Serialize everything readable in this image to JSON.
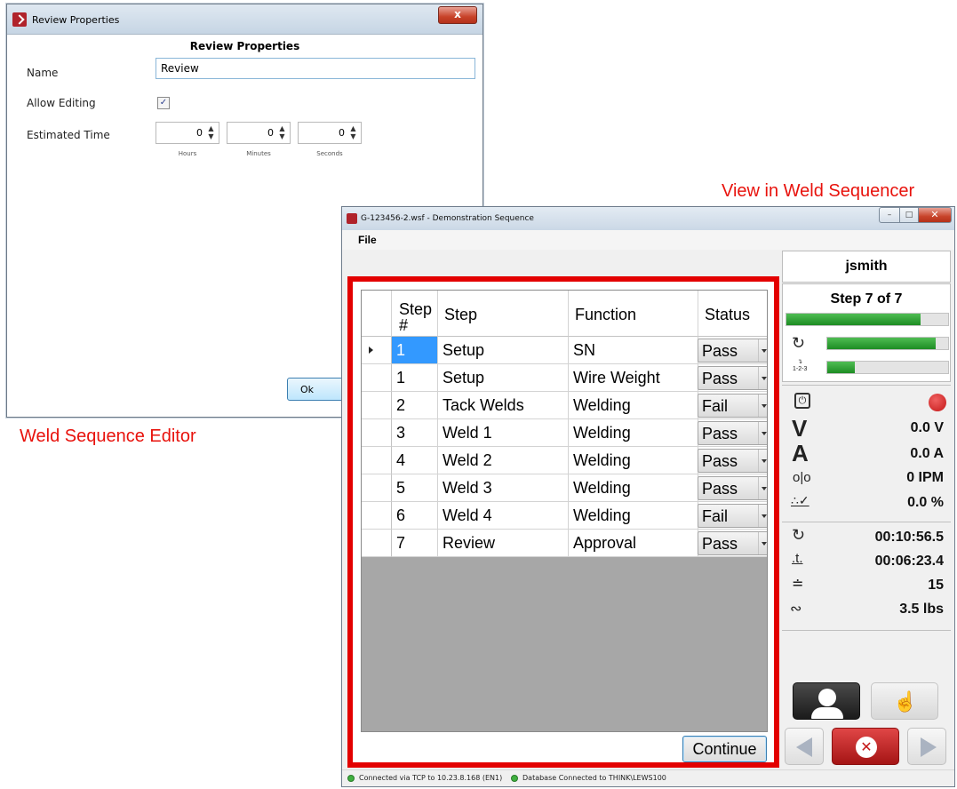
{
  "review_dialog": {
    "title": "Review Properties",
    "close_glyph": "x",
    "heading": "Review Properties",
    "name_label": "Name",
    "name_value": "Review",
    "allow_editing_label": "Allow Editing",
    "allow_editing_checked": true,
    "estimated_time_label": "Estimated Time",
    "hours_value": "0",
    "minutes_value": "0",
    "seconds_value": "0",
    "hours_caption": "Hours",
    "minutes_caption": "Minutes",
    "seconds_caption": "Seconds",
    "ok_label": "Ok"
  },
  "captions": {
    "editor": "Weld Sequence Editor",
    "sequencer": "View in Weld Sequencer"
  },
  "sequencer": {
    "title": "G-123456-2.wsf - Demonstration Sequence",
    "menu_file": "File",
    "columns": {
      "step_num_line1": "Step",
      "step_num_line2": "#",
      "step": "Step",
      "function": "Function",
      "status": "Status"
    },
    "rows": [
      {
        "num": "1",
        "step": "Setup",
        "function": "SN",
        "status": "Pass"
      },
      {
        "num": "1",
        "step": "Setup",
        "function": "Wire Weight",
        "status": "Pass"
      },
      {
        "num": "2",
        "step": "Tack Welds",
        "function": "Welding",
        "status": "Fail"
      },
      {
        "num": "3",
        "step": "Weld 1",
        "function": "Welding",
        "status": "Pass"
      },
      {
        "num": "4",
        "step": "Weld 2",
        "function": "Welding",
        "status": "Pass"
      },
      {
        "num": "5",
        "step": "Weld 3",
        "function": "Welding",
        "status": "Pass"
      },
      {
        "num": "6",
        "step": "Weld 4",
        "function": "Welding",
        "status": "Fail"
      },
      {
        "num": "7",
        "step": "Review",
        "function": "Approval",
        "status": "Pass"
      }
    ],
    "continue_label": "Continue",
    "status_bar": {
      "connection": "Connected via TCP to 10.23.8.168 (EN1)",
      "database": "Database Connected to THINK\\LEWS100"
    },
    "panel": {
      "user": "jsmith",
      "step_progress_text": "Step 7 of 7",
      "step_progress_fraction": 0.83,
      "time_progress_fraction": 0.9,
      "sequence_progress_fraction": 0.23,
      "sequence_icon_text": "1-2-3",
      "voltage_symbol": "V",
      "current_symbol": "A",
      "voltage": "0.0 V",
      "current": "0.0 A",
      "wire_feed": "0 IPM",
      "percent": "0.0 %",
      "total_time": "00:10:56.5",
      "arc_time": "00:06:23.4",
      "weld_count": "15",
      "wire_weight": "3.5 lbs"
    },
    "colors": {
      "highlight_frame": "#e30000",
      "selection": "#3399ff",
      "progress_green": "#2a9a2f",
      "record_red": "#d42020",
      "cancel_red": "#cc1e1e"
    }
  }
}
